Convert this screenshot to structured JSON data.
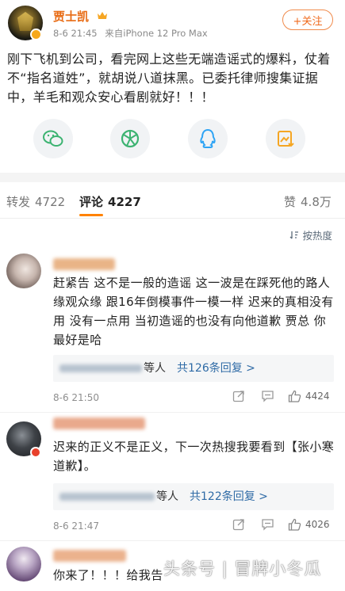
{
  "post": {
    "author_name": "贾士凯",
    "date": "8-6 21:45",
    "source": "来自iPhone 12 Pro Max",
    "follow_label": "+关注",
    "text": "刚下飞机到公司，看完网上这些无端造谣式的爆料，仗着不“指名道姓”，就胡说八道抹黑。已委托律师搜集证据中，羊毛和观众安心看剧就好！！！",
    "share_icons": [
      "wechat-icon",
      "moments-icon",
      "qq-icon",
      "save-image-icon"
    ]
  },
  "tabs": {
    "repost_label": "转发",
    "repost_count": "4722",
    "comment_label": "评论",
    "comment_count": "4227",
    "like_label": "赞",
    "like_count": "4.8万"
  },
  "sort": {
    "label": "按热度"
  },
  "comments": [
    {
      "text": "赶紧告 这不是一般的造谣 这一波是在踩死他的路人缘观众缘 跟16年倒模事件一模一样 迟来的真相没有用 没有一点用 当初造谣的也没有向他道歉 贾总 你最好是哈",
      "reply_suffix": "等人",
      "reply_link": "共126条回复 >",
      "time": "8-6 21:50",
      "likes": "4424"
    },
    {
      "text": "迟来的正义不是正义，下一次热搜我要看到【张小寒道歉】。",
      "reply_suffix": "等人",
      "reply_link": "共122条回复 >",
      "time": "8-6 21:47",
      "likes": "4026"
    },
    {
      "text": "你来了！！！给我告",
      "reply_suffix": "",
      "reply_link": "",
      "time": "",
      "likes": ""
    }
  ],
  "watermark": "头条号 | 冒牌小冬瓜",
  "colors": {
    "author_orange": "#e86b14",
    "follow_orange": "#f06a1c",
    "tab_indicator": "#ff8200",
    "link_blue": "#2f6ba6"
  }
}
